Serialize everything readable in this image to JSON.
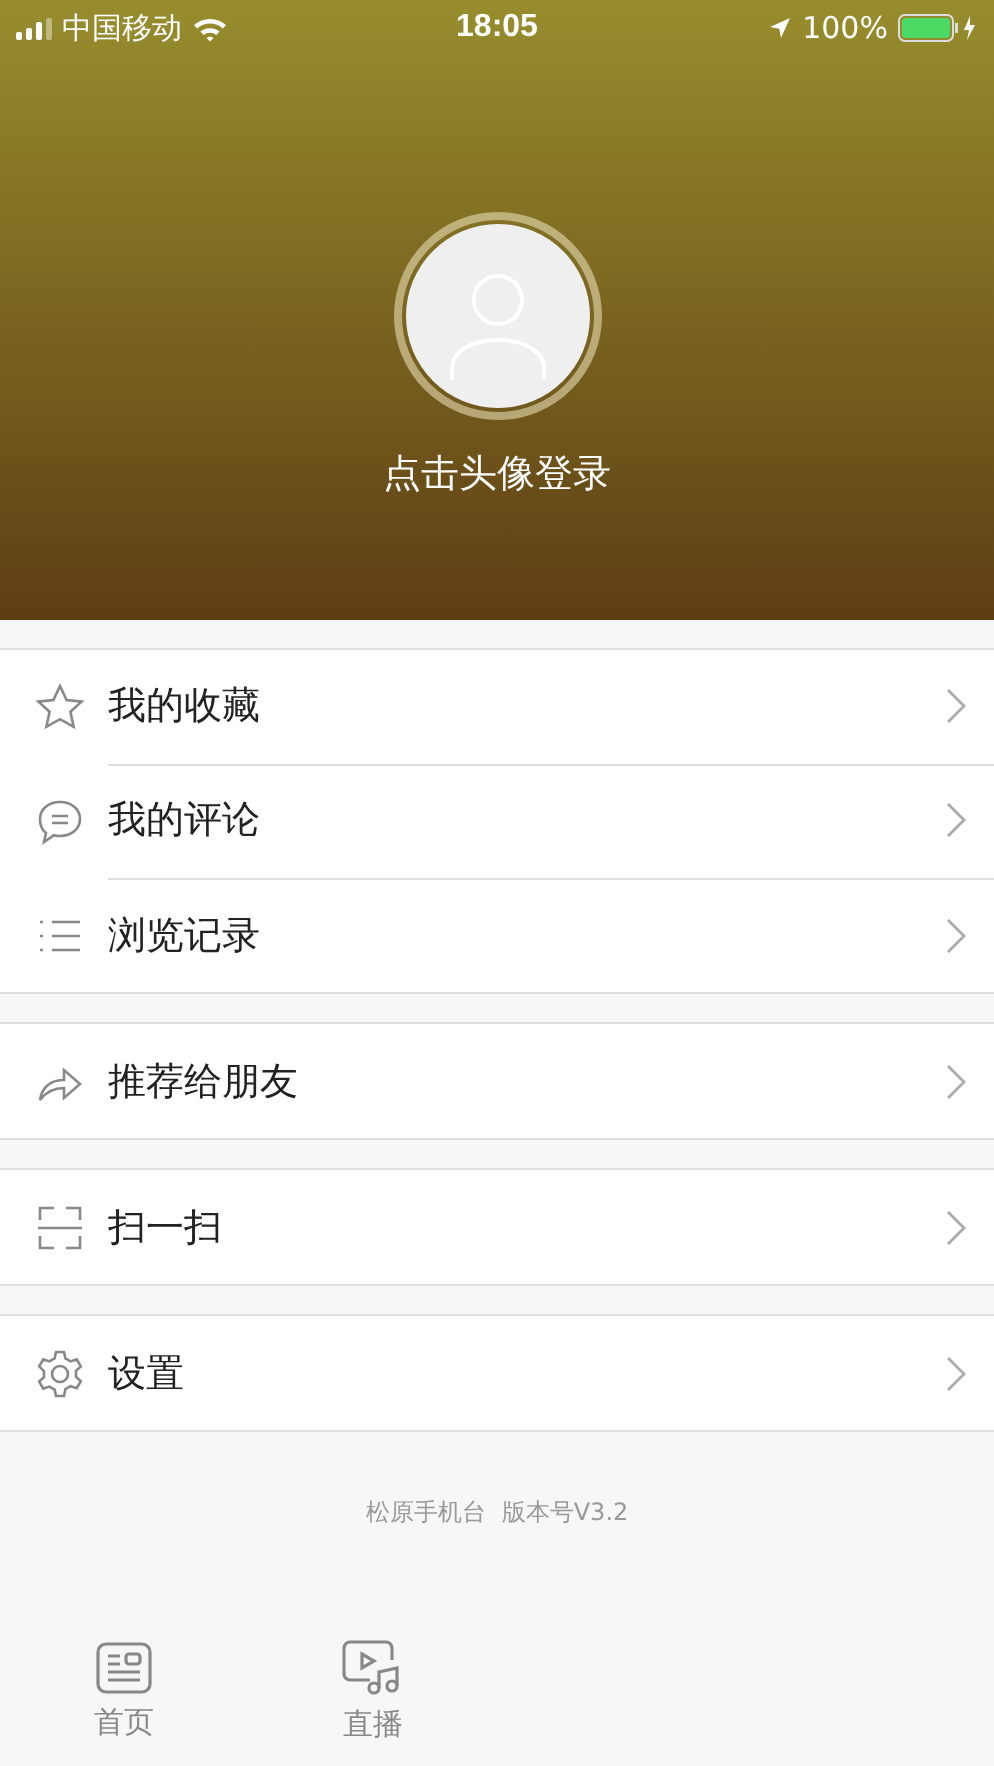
{
  "status_bar": {
    "carrier": "中国移动",
    "time": "18:05",
    "battery": "100%"
  },
  "profile": {
    "login_prompt": "点击头像登录"
  },
  "menu_groups": [
    {
      "items": [
        {
          "label": "我的收藏",
          "kind": "star"
        },
        {
          "label": "我的评论",
          "kind": "comment"
        },
        {
          "label": "浏览记录",
          "kind": "list"
        }
      ]
    },
    {
      "items": [
        {
          "label": "推荐给朋友",
          "kind": "share"
        }
      ]
    },
    {
      "items": [
        {
          "label": "扫一扫",
          "kind": "scan"
        }
      ]
    },
    {
      "items": [
        {
          "label": "设置",
          "kind": "gear"
        }
      ]
    }
  ],
  "footer": {
    "app_name": "松原手机台",
    "version": "版本号V3.2"
  },
  "tab_bar": [
    {
      "label": "首页",
      "kind": "news"
    },
    {
      "label": "直播",
      "kind": "live"
    }
  ]
}
